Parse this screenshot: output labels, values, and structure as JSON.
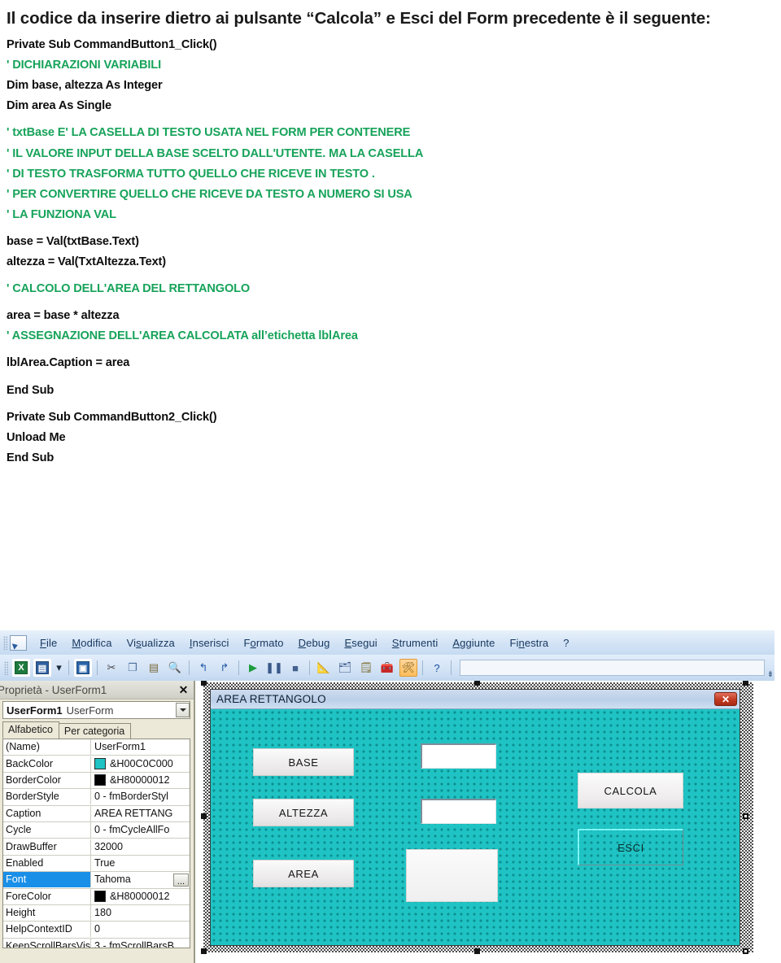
{
  "document": {
    "heading": "Il codice da inserire dietro ai pulsante “Calcola” e Esci del Form precedente è il seguente:",
    "code_lines": [
      {
        "text": "Private Sub CommandButton1_Click()",
        "kind": "code"
      },
      {
        "text": "' DICHIARAZIONI VARIABILI",
        "kind": "comment"
      },
      {
        "text": "Dim base, altezza As Integer",
        "kind": "code"
      },
      {
        "text": "Dim area As Single",
        "kind": "code"
      },
      {
        "text": "",
        "kind": "blank"
      },
      {
        "text": "' txtBase E' LA CASELLA DI TESTO USATA NEL FORM PER CONTENERE",
        "kind": "comment"
      },
      {
        "text": "' IL VALORE INPUT DELLA BASE SCELTO DALL'UTENTE. MA LA CASELLA",
        "kind": "comment"
      },
      {
        "text": "' DI TESTO TRASFORMA TUTTO QUELLO CHE RICEVE IN TESTO .",
        "kind": "comment"
      },
      {
        "text": "' PER CONVERTIRE QUELLO CHE RICEVE DA TESTO A NUMERO SI USA",
        "kind": "comment"
      },
      {
        "text": "' LA FUNZIONA VAL",
        "kind": "comment"
      },
      {
        "text": "",
        "kind": "blank"
      },
      {
        "text": "base = Val(txtBase.Text)",
        "kind": "code"
      },
      {
        "text": "altezza = Val(TxtAltezza.Text)",
        "kind": "code"
      },
      {
        "text": "",
        "kind": "blank"
      },
      {
        "text": "' CALCOLO DELL'AREA DEL RETTANGOLO",
        "kind": "comment"
      },
      {
        "text": "",
        "kind": "blank"
      },
      {
        "text": "area = base * altezza",
        "kind": "code"
      },
      {
        "text": "' ASSEGNAZIONE DELL'AREA CALCOLATA all’etichetta lblArea",
        "kind": "comment"
      },
      {
        "text": "",
        "kind": "blank"
      },
      {
        "text": "lblArea.Caption = area",
        "kind": "code"
      },
      {
        "text": "",
        "kind": "blank"
      },
      {
        "text": "End Sub",
        "kind": "code"
      },
      {
        "text": "",
        "kind": "blank"
      },
      {
        "text": "Private Sub CommandButton2_Click()",
        "kind": "code"
      },
      {
        "text": "Unload Me",
        "kind": "code"
      },
      {
        "text": "End Sub",
        "kind": "code"
      }
    ],
    "comment_color": "#17a35a",
    "code_color": "#0d0d0d"
  },
  "ide": {
    "menubar": {
      "app_icon": "vba-project-icon",
      "items": [
        {
          "label": "File",
          "accel": "F"
        },
        {
          "label": "Modifica",
          "accel": "M"
        },
        {
          "label": "Visualizza",
          "accel": "s"
        },
        {
          "label": "Inserisci",
          "accel": "I"
        },
        {
          "label": "Formato",
          "accel": "o"
        },
        {
          "label": "Debug",
          "accel": "D"
        },
        {
          "label": "Esegui",
          "accel": "E"
        },
        {
          "label": "Strumenti",
          "accel": "S"
        },
        {
          "label": "Aggiunte",
          "accel": "A"
        },
        {
          "label": "Finestra",
          "accel": "n"
        },
        {
          "label": "?",
          "accel": "?"
        }
      ]
    },
    "toolbar": {
      "icons": [
        {
          "name": "view-excel-icon",
          "highlight": false
        },
        {
          "name": "insert-userform-icon",
          "highlight": false
        },
        {
          "name": "dropdown-arrow-icon",
          "highlight": false
        },
        {
          "name": "save-icon",
          "highlight": false
        },
        {
          "name": "cut-icon",
          "highlight": false
        },
        {
          "name": "copy-icon",
          "highlight": false
        },
        {
          "name": "paste-icon",
          "highlight": false
        },
        {
          "name": "find-icon",
          "highlight": false
        },
        {
          "name": "undo-icon",
          "highlight": false
        },
        {
          "name": "redo-icon",
          "highlight": false
        },
        {
          "name": "run-icon",
          "highlight": false
        },
        {
          "name": "pause-icon",
          "highlight": false
        },
        {
          "name": "stop-icon",
          "highlight": false
        },
        {
          "name": "design-mode-icon",
          "highlight": false
        },
        {
          "name": "project-explorer-icon",
          "highlight": false
        },
        {
          "name": "properties-window-icon",
          "highlight": false
        },
        {
          "name": "object-browser-icon",
          "highlight": false
        },
        {
          "name": "toolbox-icon",
          "highlight": true
        },
        {
          "name": "help-icon",
          "highlight": false
        }
      ]
    },
    "properties_window": {
      "title": "Proprietà - UserForm1",
      "close_label": "✕",
      "object_name": "UserForm1",
      "object_type": "UserForm",
      "tabs": [
        {
          "label": "Alfabetico",
          "active": true
        },
        {
          "label": "Per categoria",
          "active": false
        }
      ],
      "rows": [
        {
          "key": "(Name)",
          "value": "UserForm1",
          "swatch": null,
          "ellipsis": false,
          "selected": false
        },
        {
          "key": "BackColor",
          "value": "&H00C0C000",
          "swatch": "#1fc3c3",
          "ellipsis": false,
          "selected": false
        },
        {
          "key": "BorderColor",
          "value": "&H80000012",
          "swatch": "#000000",
          "ellipsis": false,
          "selected": false
        },
        {
          "key": "BorderStyle",
          "value": "0 - fmBorderStyl",
          "swatch": null,
          "ellipsis": false,
          "selected": false
        },
        {
          "key": "Caption",
          "value": "AREA RETTANG",
          "swatch": null,
          "ellipsis": false,
          "selected": false
        },
        {
          "key": "Cycle",
          "value": "0 - fmCycleAllFo",
          "swatch": null,
          "ellipsis": false,
          "selected": false
        },
        {
          "key": "DrawBuffer",
          "value": "32000",
          "swatch": null,
          "ellipsis": false,
          "selected": false
        },
        {
          "key": "Enabled",
          "value": "True",
          "swatch": null,
          "ellipsis": false,
          "selected": false
        },
        {
          "key": "Font",
          "value": "Tahoma",
          "swatch": null,
          "ellipsis": true,
          "selected": true
        },
        {
          "key": "ForeColor",
          "value": "&H80000012",
          "swatch": "#000000",
          "ellipsis": false,
          "selected": false
        },
        {
          "key": "Height",
          "value": "180",
          "swatch": null,
          "ellipsis": false,
          "selected": false
        },
        {
          "key": "HelpContextID",
          "value": "0",
          "swatch": null,
          "ellipsis": false,
          "selected": false
        },
        {
          "key": "KeepScrollBarsVisi",
          "value": "3 - fmScrollBarsB",
          "swatch": null,
          "ellipsis": false,
          "selected": false
        }
      ],
      "ellipsis_label": "..."
    },
    "designer": {
      "form_caption": "AREA RETTANGOLO",
      "close_label": "✕",
      "back_color": "#1fc3c3",
      "controls": [
        {
          "name": "label-base",
          "type": "label",
          "text": "BASE"
        },
        {
          "name": "label-altezza",
          "type": "label",
          "text": "ALTEZZA"
        },
        {
          "name": "label-area",
          "type": "label",
          "text": "AREA"
        },
        {
          "name": "textbox-base",
          "type": "textbox",
          "text": ""
        },
        {
          "name": "textbox-altezza",
          "type": "textbox",
          "text": ""
        },
        {
          "name": "label-area-result",
          "type": "label-output",
          "text": ""
        },
        {
          "name": "button-calcola",
          "type": "button",
          "text": "CALCOLA"
        },
        {
          "name": "button-esci",
          "type": "button",
          "text": "ESCI"
        }
      ]
    }
  }
}
